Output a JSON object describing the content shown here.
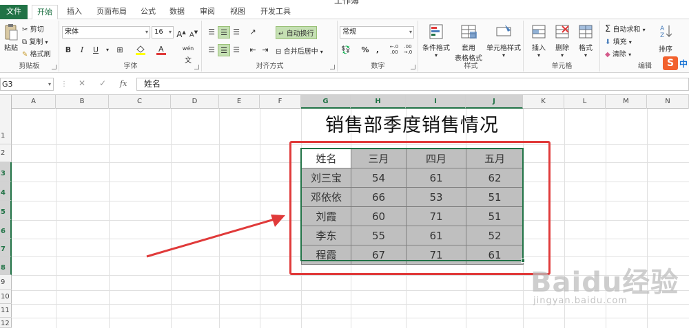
{
  "window": {
    "title_fragment": "工作簿"
  },
  "tabs": [
    {
      "label": "文件",
      "kind": "file"
    },
    {
      "label": "开始",
      "kind": "active"
    },
    {
      "label": "插入"
    },
    {
      "label": "页面布局"
    },
    {
      "label": "公式"
    },
    {
      "label": "数据"
    },
    {
      "label": "审阅"
    },
    {
      "label": "视图"
    },
    {
      "label": "开发工具"
    }
  ],
  "ribbon": {
    "clipboard": {
      "label": "剪贴板",
      "paste": "粘贴",
      "cut": "剪切",
      "copy": "复制",
      "format_painter": "格式刷"
    },
    "font": {
      "label": "字体",
      "family": "宋体",
      "size": "16",
      "grow": "A",
      "shrink": "A",
      "bold": "B",
      "italic": "I",
      "underline": "U",
      "phonetic": "wén"
    },
    "alignment": {
      "label": "对齐方式",
      "wrap": "自动换行",
      "merge": "合并后居中"
    },
    "number": {
      "label": "数字",
      "format": "常规",
      "percent": "%",
      "comma": ",",
      "inc_decimal": "←.0\n.00",
      "dec_decimal": ".00\n→.0"
    },
    "styles": {
      "label": "样式",
      "conditional": "条件格式",
      "table_line1": "套用",
      "table_line2": "表格格式",
      "cell_styles": "单元格样式"
    },
    "cells": {
      "label": "单元格",
      "insert": "插入",
      "delete": "删除",
      "format": "格式"
    },
    "editing": {
      "label": "编辑",
      "autosum": "自动求和",
      "fill": "填充",
      "clear": "清除",
      "sort": "排序"
    }
  },
  "formula_bar": {
    "name_box": "G3",
    "content": "姓名",
    "fx": "fx"
  },
  "columns": [
    "A",
    "B",
    "C",
    "D",
    "E",
    "F",
    "G",
    "H",
    "I",
    "J",
    "K",
    "L",
    "M",
    "N"
  ],
  "rows": [
    "1",
    "2",
    "3",
    "4",
    "5",
    "6",
    "7",
    "8",
    "9",
    "10",
    "11",
    "12"
  ],
  "sheet": {
    "title": "销售部季度销售情况",
    "table_header": [
      "姓名",
      "三月",
      "四月",
      "五月"
    ],
    "table_rows": [
      [
        "刘三宝",
        "54",
        "61",
        "62"
      ],
      [
        "邓依依",
        "66",
        "53",
        "51"
      ],
      [
        "刘霞",
        "60",
        "71",
        "51"
      ],
      [
        "李东",
        "55",
        "61",
        "52"
      ],
      [
        "程霞",
        "67",
        "71",
        "61"
      ]
    ]
  },
  "watermark": {
    "main": "Baidu经验",
    "sub": "jingyan.baidu.com"
  },
  "ime": {
    "badge": "S",
    "mode": "中"
  },
  "colors": {
    "excel_green": "#217346",
    "annotation_red": "#e03a3a",
    "cell_gray": "#bfbfbf"
  }
}
